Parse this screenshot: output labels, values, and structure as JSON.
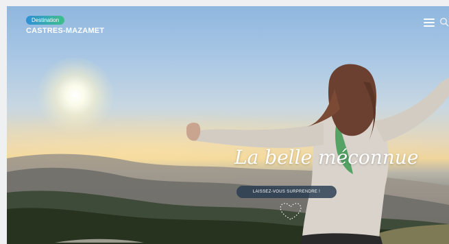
{
  "header": {
    "logo_badge": "Destination",
    "logo_name": "CASTRES-MAZAMET",
    "menu_icon": "hamburger-menu-icon",
    "search_icon": "search-icon"
  },
  "hero": {
    "tagline": "La belle méconnue",
    "cta_label": "LAISSEZ-VOUS SURPRENDRE !",
    "scroll_icon": "dotted-heart-scroll-icon"
  },
  "colors": {
    "badge_gradient_start": "#2f8fd8",
    "badge_gradient_end": "#3ec08a",
    "cta_background": "#283c50",
    "text": "#ffffff"
  }
}
